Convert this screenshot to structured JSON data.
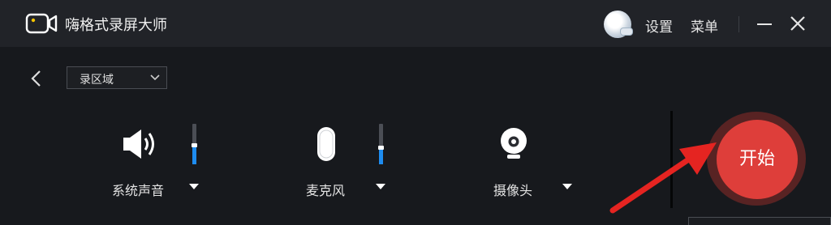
{
  "app": {
    "title": "嗨格式录屏大师"
  },
  "header": {
    "settings_label": "设置",
    "menu_label": "菜单"
  },
  "toolbar": {
    "mode_select_value": "录区域"
  },
  "devices": {
    "system_audio": {
      "label": "系统声音",
      "level": 0.45
    },
    "microphone": {
      "label": "麦克风",
      "level": 0.4
    },
    "camera": {
      "label": "摄像头"
    }
  },
  "start_button": {
    "label": "开始"
  },
  "colors": {
    "accent_blue": "#1e8cf0",
    "start_red": "#de3e3a",
    "annotation_arrow": "#e52421"
  },
  "icons": [
    "camera-logo-icon",
    "user-avatar-icon",
    "minimize-icon",
    "close-icon",
    "back-arrow-icon",
    "chevron-down-icon",
    "speaker-icon",
    "microphone-icon",
    "webcam-icon",
    "dropdown-triangle-icon",
    "red-arrow-annotation"
  ]
}
